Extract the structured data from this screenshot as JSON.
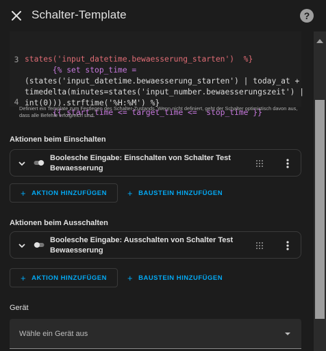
{
  "dialog": {
    "title": "Schalter-Template"
  },
  "editor": {
    "lines": [
      {
        "num": "",
        "text": "states('input_datetime.bewaesserung_starten')  %}"
      },
      {
        "num": "3",
        "text": "      {% set stop_time ="
      },
      {
        "num": "",
        "text": "(states('input_datetime.bewaesserung_starten') | today_at +"
      },
      {
        "num": "",
        "text": "timedelta(minutes=states('input_number.bewaesserungszeit') |"
      },
      {
        "num": "",
        "text": "int(0))).strftime('%H:%M') %}"
      },
      {
        "num": "4",
        "text": "      {{ start_time <= target_time <=  stop_time }}"
      }
    ]
  },
  "helper_text": "Definiert ein Template zum Festlegen des Schalter-Zustands. Wenn nicht definiert, geht der Schalter optimistisch davon aus, dass alle Befehle erfolgreich sind.",
  "turn_on": {
    "label": "Aktionen beim Einschalten",
    "action_text": "Boolesche Eingabe: Einschalten von Schalter Test Bewaesserung",
    "add_action": "AKTION HINZUFÜGEN",
    "add_block": "BAUSTEIN HINZUFÜGEN"
  },
  "turn_off": {
    "label": "Aktionen beim Ausschalten",
    "action_text": "Boolesche Eingabe: Ausschalten von Schalter Test Bewaesserung",
    "add_action": "AKTION HINZUFÜGEN",
    "add_block": "BAUSTEIN HINZUFÜGEN"
  },
  "device": {
    "label": "Gerät",
    "placeholder": "Wähle ein Gerät aus"
  },
  "icons": [
    "close-icon",
    "help-icon",
    "chevron-down-icon",
    "toggle-icon",
    "drag-handle-icon",
    "more-vert-icon",
    "plus-icon",
    "dropdown-arrow-icon"
  ],
  "colors": {
    "accent": "#03a9f4",
    "background": "#1c1c1c",
    "code_keyword": "#c678dd",
    "code_variable": "#e06c75"
  }
}
